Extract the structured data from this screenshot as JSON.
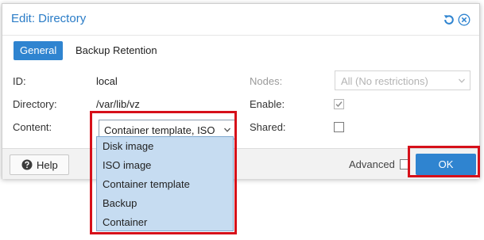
{
  "dialog": {
    "title": "Edit: Directory",
    "tools": {
      "reset": "reset-icon",
      "close": "close-icon"
    },
    "tabs": [
      {
        "label": "General",
        "active": true
      },
      {
        "label": "Backup Retention",
        "active": false
      }
    ]
  },
  "form": {
    "id_label": "ID:",
    "id_value": "local",
    "directory_label": "Directory:",
    "directory_value": "/var/lib/vz",
    "content_label": "Content:",
    "content_value": "Container template, ISO image, Disk image, Backup, Container",
    "nodes_label": "Nodes:",
    "nodes_placeholder": "All (No restrictions)",
    "enable_label": "Enable:",
    "enable_checked": true,
    "shared_label": "Shared:",
    "shared_checked": false
  },
  "dropdown": {
    "options": [
      "Disk image",
      "ISO image",
      "Container template",
      "Backup",
      "Container"
    ]
  },
  "footer": {
    "help_label": "Help",
    "advanced_label": "Advanced",
    "advanced_checked": false,
    "ok_label": "OK"
  },
  "colors": {
    "accent": "#2f84d0",
    "title": "#2a7cc7",
    "highlight": "#d6101a",
    "dropdown_bg": "#c6dcf1"
  }
}
